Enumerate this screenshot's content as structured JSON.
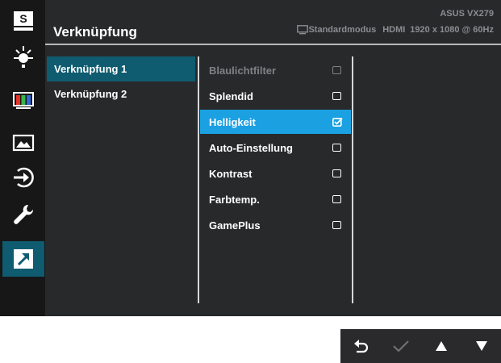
{
  "header": {
    "title": "Verknüpfung",
    "model": "ASUS VX279",
    "mode": "Standardmodus",
    "input": "HDMI",
    "resolution": "1920 x 1080 @ 60Hz"
  },
  "sidebar": {
    "items": [
      {
        "name": "splendid-icon",
        "label": "S"
      },
      {
        "name": "blue-light-filter-icon"
      },
      {
        "name": "color-icon"
      },
      {
        "name": "image-icon"
      },
      {
        "name": "input-select-icon"
      },
      {
        "name": "system-setup-icon"
      },
      {
        "name": "shortcut-icon",
        "active": true
      }
    ]
  },
  "shortcut_menu": {
    "items": [
      {
        "label": "Verknüpfung 1",
        "selected": true
      },
      {
        "label": "Verknüpfung 2",
        "selected": false
      }
    ]
  },
  "options": {
    "items": [
      {
        "label": "Blaulichtfilter",
        "checked": false,
        "disabled": true
      },
      {
        "label": "Splendid",
        "checked": false
      },
      {
        "label": "Helligkeit",
        "checked": true,
        "highlight": true
      },
      {
        "label": "Auto-Einstellung",
        "checked": false
      },
      {
        "label": "Kontrast",
        "checked": false
      },
      {
        "label": "Farbtemp.",
        "checked": false
      },
      {
        "label": "GamePlus",
        "checked": false
      }
    ]
  },
  "buttons": [
    {
      "name": "back-icon"
    },
    {
      "name": "confirm-icon"
    },
    {
      "name": "up-arrow-icon"
    },
    {
      "name": "down-arrow-icon"
    }
  ],
  "colors": {
    "osd_background": "#28292b",
    "sidebar_background": "#171717",
    "selected_teal": "#0f5b70",
    "highlight_blue": "#1ba0e2"
  }
}
